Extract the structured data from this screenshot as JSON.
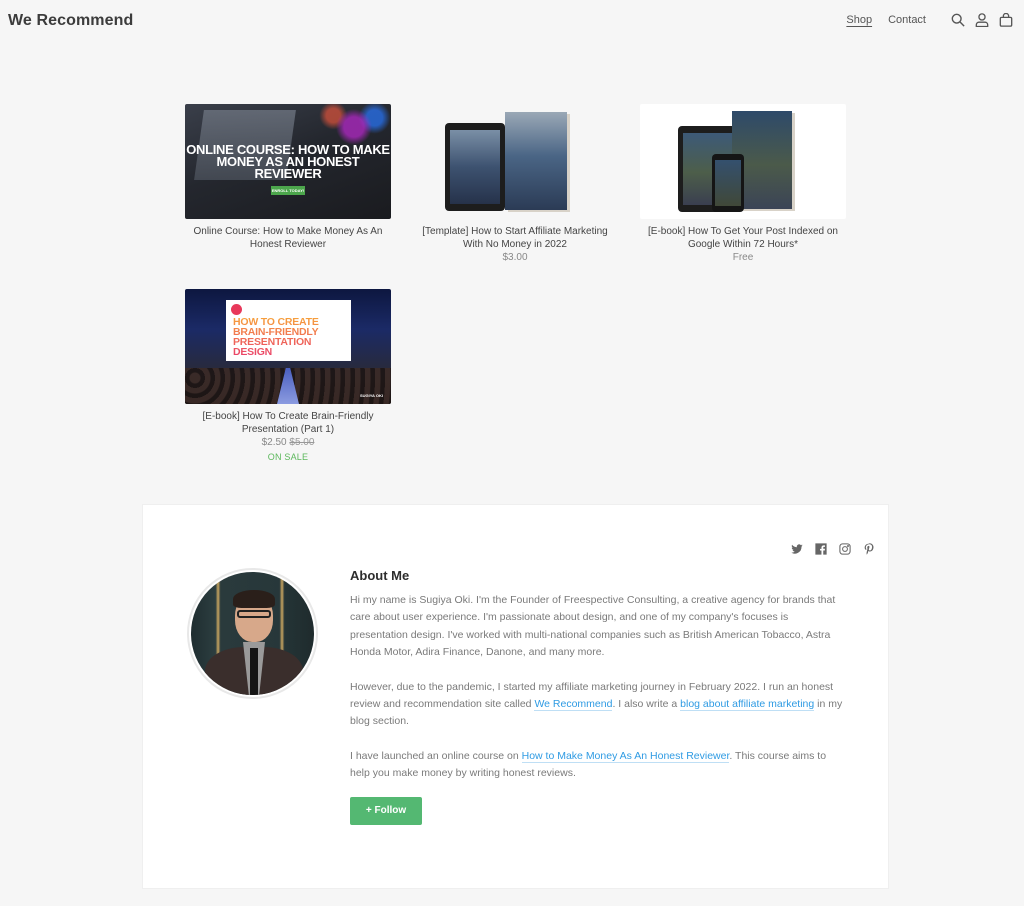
{
  "header": {
    "brand": "We Recommend",
    "nav": [
      {
        "label": "Shop",
        "active": true
      },
      {
        "label": "Contact",
        "active": false
      }
    ],
    "icons": [
      "search-icon",
      "account-icon",
      "cart-icon"
    ]
  },
  "products": [
    {
      "title": "Online Course: How to Make Money As An Honest Reviewer",
      "image_text": "ONLINE COURSE: HOW TO MAKE MONEY AS AN HONEST REVIEWER",
      "image_button": "ENROLL TODAY!",
      "price": "",
      "original_price": "",
      "badge": ""
    },
    {
      "title": "[Template] How to Start Affiliate Marketing With No Money in 2022",
      "price": "$3.00",
      "original_price": "",
      "badge": ""
    },
    {
      "title": "[E-book] How To Get Your Post Indexed on Google Within 72 Hours*",
      "price": "Free",
      "original_price": "",
      "badge": ""
    },
    {
      "title": "[E-book] How To Create Brain-Friendly Presentation (Part 1)",
      "image_text": "HOW TO CREATE BRAIN-FRIENDLY PRESENTATION DESIGN",
      "image_signature": "SUGIYA OKI",
      "price": "$2.50",
      "original_price": "$5.00",
      "badge": "ON SALE"
    }
  ],
  "about": {
    "heading": "About Me",
    "social_icons": [
      "twitter-icon",
      "facebook-icon",
      "instagram-icon",
      "pinterest-icon"
    ],
    "p1": "Hi my name is Sugiya Oki. I'm the Founder of Freespective Consulting, a creative agency for brands that care about user experience. I'm passionate about design, and one of my company's focuses is presentation design. I've worked with multi-national companies such as British American Tobacco, Astra Honda Motor, Adira Finance, Danone, and many more.",
    "p2_a": "However, due to the pandemic, I started my affiliate marketing journey in February 2022. I run an honest review and recommendation site called ",
    "p2_link1": "We Recommend",
    "p2_b": ". I also write a ",
    "p2_link2": "blog about affiliate marketing",
    "p2_c": " in my blog section.",
    "p3_a": "I have launched an online course on ",
    "p3_link": "How to Make Money As An Honest Reviewer",
    "p3_b": ". This course aims to help you make money by writing honest reviews.",
    "follow_label": "+ Follow"
  },
  "colors": {
    "background": "#f6f6f6",
    "link": "#2f9be3",
    "follow": "#54b872",
    "sale": "#5cb85c"
  }
}
